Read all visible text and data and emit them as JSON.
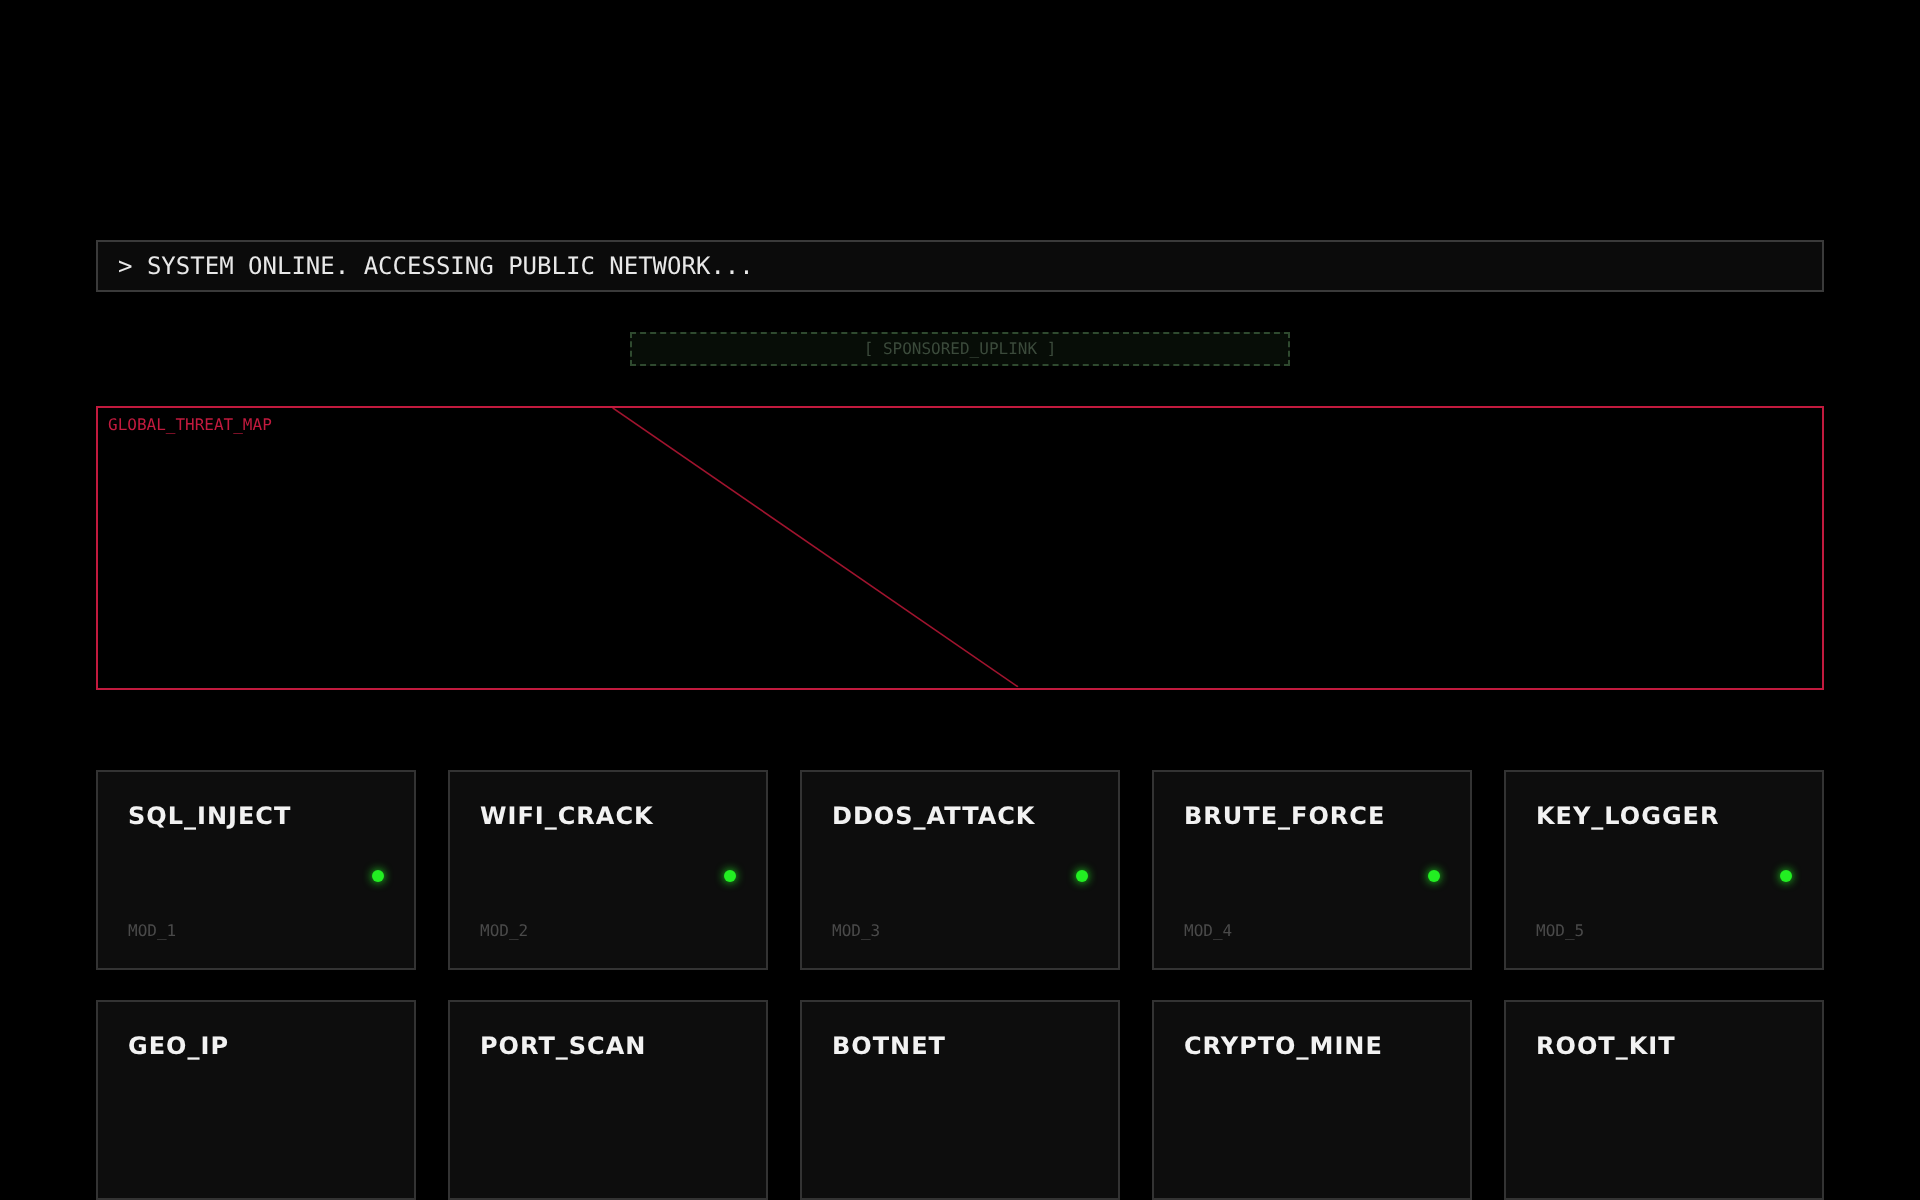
{
  "console": {
    "text": "> SYSTEM ONLINE. ACCESSING PUBLIC NETWORK..."
  },
  "sponsored": {
    "text": "[ SPONSORED_UPLINK ]"
  },
  "threat_map": {
    "title": "GLOBAL_THREAT_MAP"
  },
  "modules": [
    {
      "name": "SQL_INJECT",
      "online": true,
      "id": "MOD_1"
    },
    {
      "name": "WIFI_CRACK",
      "online": true,
      "id": "MOD_2"
    },
    {
      "name": "DDOS_ATTACK",
      "online": true,
      "id": "MOD_3"
    },
    {
      "name": "BRUTE_FORCE",
      "online": true,
      "id": "MOD_4"
    },
    {
      "name": "KEY_LOGGER",
      "online": true,
      "id": "MOD_5"
    },
    {
      "name": "GEO_IP"
    },
    {
      "name": "PORT_SCAN"
    },
    {
      "name": "BOTNET"
    },
    {
      "name": "CRYPTO_MINE"
    },
    {
      "name": "ROOT_KIT"
    }
  ]
}
